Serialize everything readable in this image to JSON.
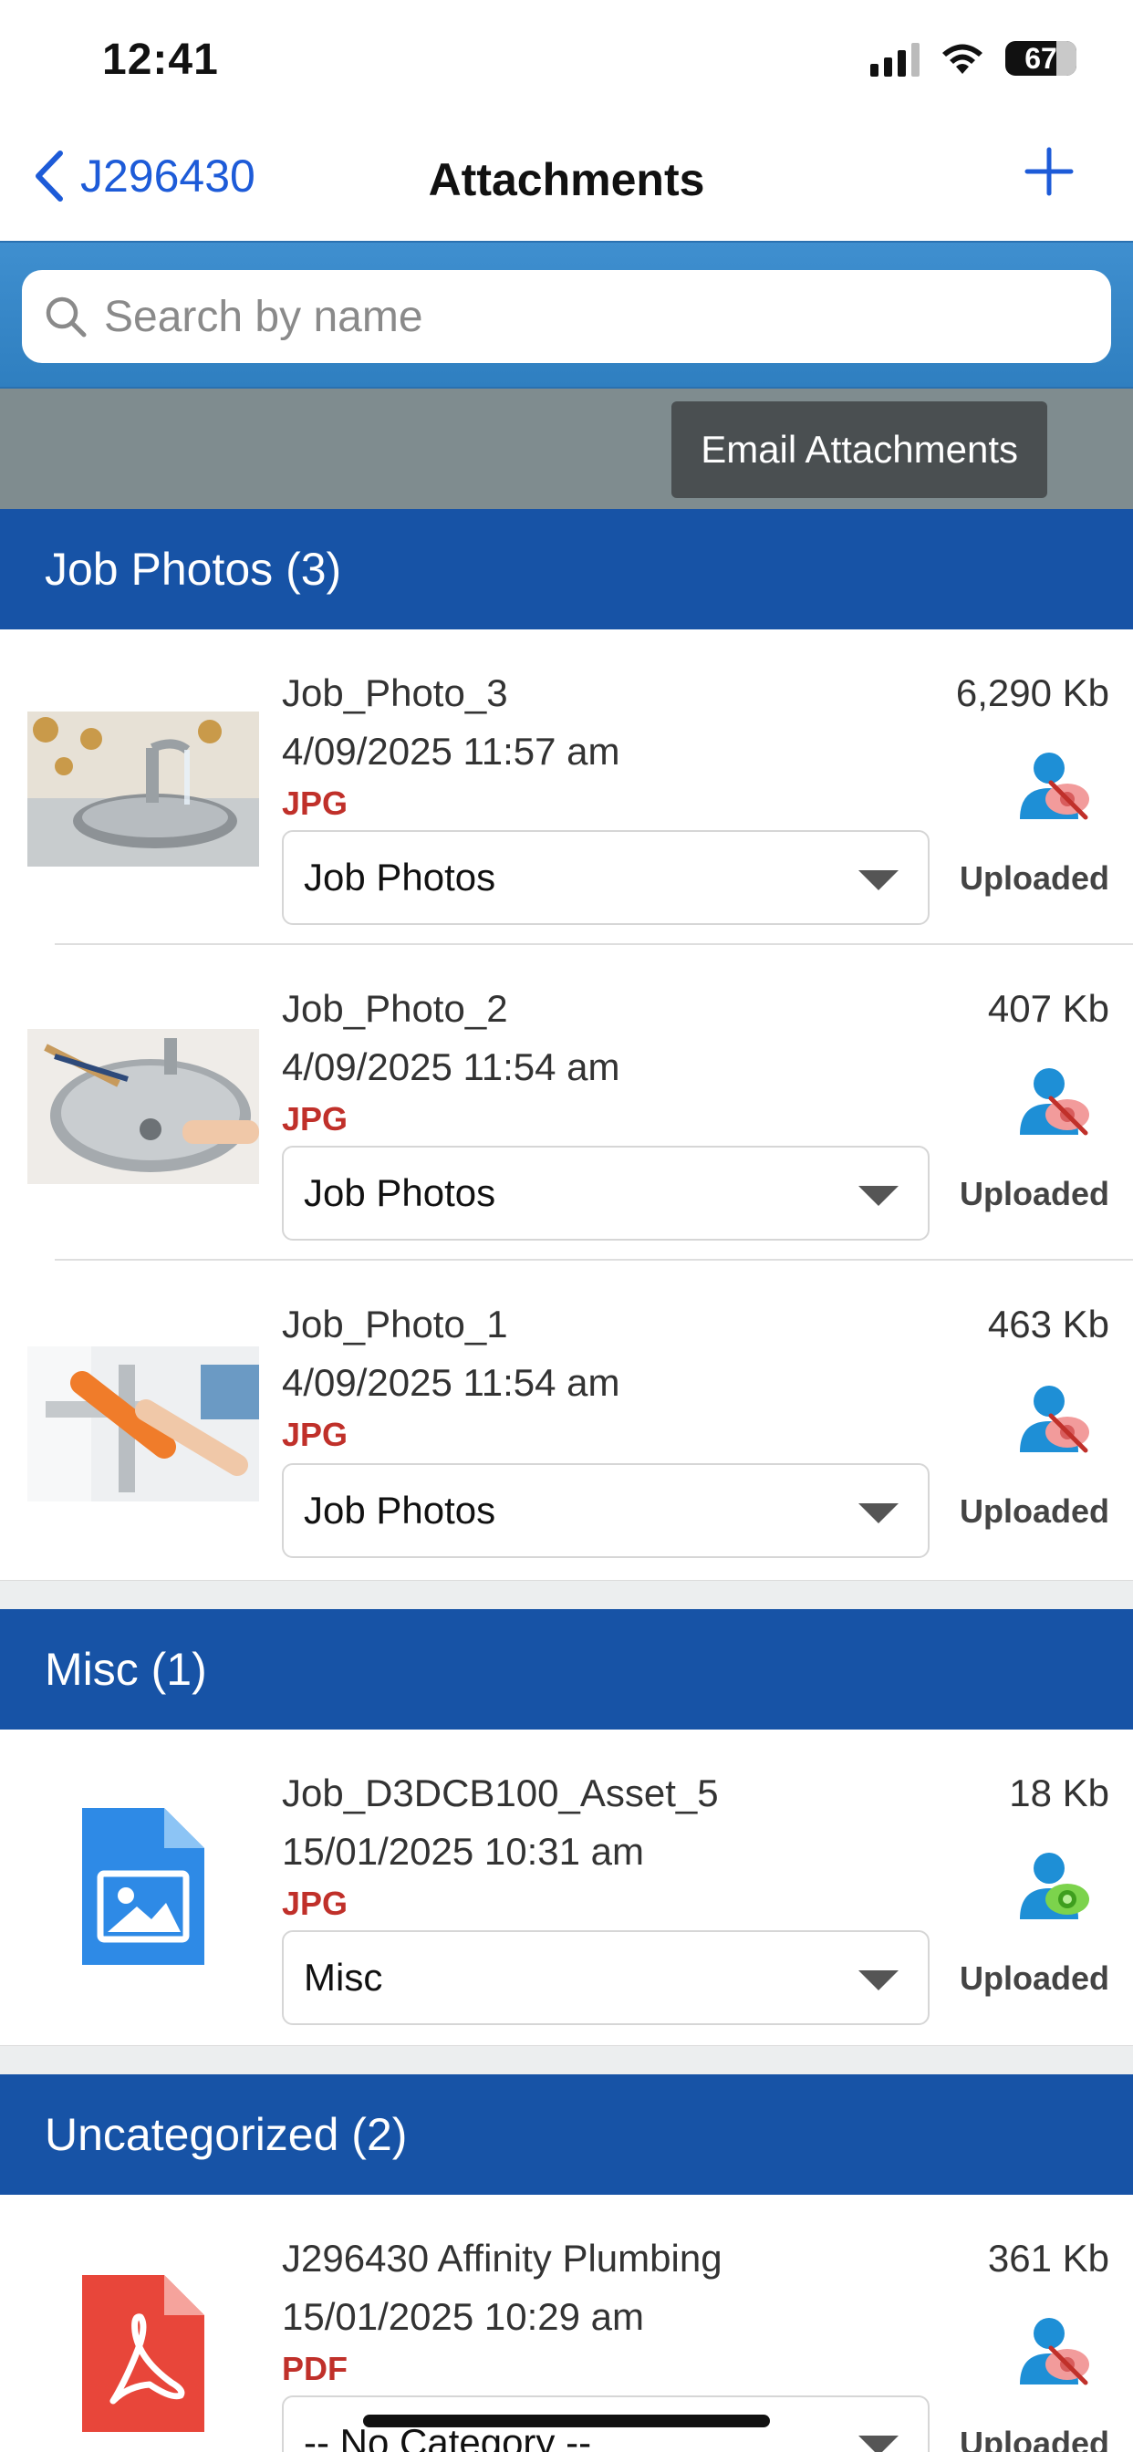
{
  "status_bar": {
    "time": "12:41",
    "battery": "67"
  },
  "nav": {
    "back_label": "J296430",
    "title": "Attachments",
    "add_icon": "plus-icon"
  },
  "search": {
    "placeholder": "Search by name",
    "value": ""
  },
  "toolbar": {
    "email_label": "Email Attachments"
  },
  "sections": [
    {
      "title": "Job Photos (3)",
      "items": [
        {
          "name": "Job_Photo_3",
          "date": "4/09/2025 11:57 am",
          "type": "JPG",
          "category": "Job Photos",
          "size": "6,290 Kb",
          "status": "Uploaded",
          "visibility_icon": "user-hidden-icon"
        },
        {
          "name": "Job_Photo_2",
          "date": "4/09/2025 11:54 am",
          "type": "JPG",
          "category": "Job Photos",
          "size": "407 Kb",
          "status": "Uploaded",
          "visibility_icon": "user-hidden-icon"
        },
        {
          "name": "Job_Photo_1",
          "date": "4/09/2025 11:54 am",
          "type": "JPG",
          "category": "Job Photos",
          "size": "463 Kb",
          "status": "Uploaded",
          "visibility_icon": "user-hidden-icon"
        }
      ]
    },
    {
      "title": "Misc (1)",
      "items": [
        {
          "name": "Job_D3DCB100_Asset_5",
          "date": "15/01/2025 10:31 am",
          "type": "JPG",
          "category": "Misc",
          "size": "18 Kb",
          "status": "Uploaded",
          "visibility_icon": "user-visible-icon"
        }
      ]
    },
    {
      "title": "Uncategorized (2)",
      "items": [
        {
          "name": "J296430 Affinity Plumbing",
          "date": "15/01/2025 10:29 am",
          "type": "PDF",
          "category": "-- No Category --",
          "size": "361 Kb",
          "status": "Uploaded",
          "visibility_icon": "user-hidden-icon"
        }
      ]
    }
  ],
  "colors": {
    "accent": "#1d5bd8",
    "section_header": "#1753a6",
    "file_type": "#c0302a",
    "search_bar": "#3a88c8",
    "toolbar": "#7f8c8f"
  }
}
